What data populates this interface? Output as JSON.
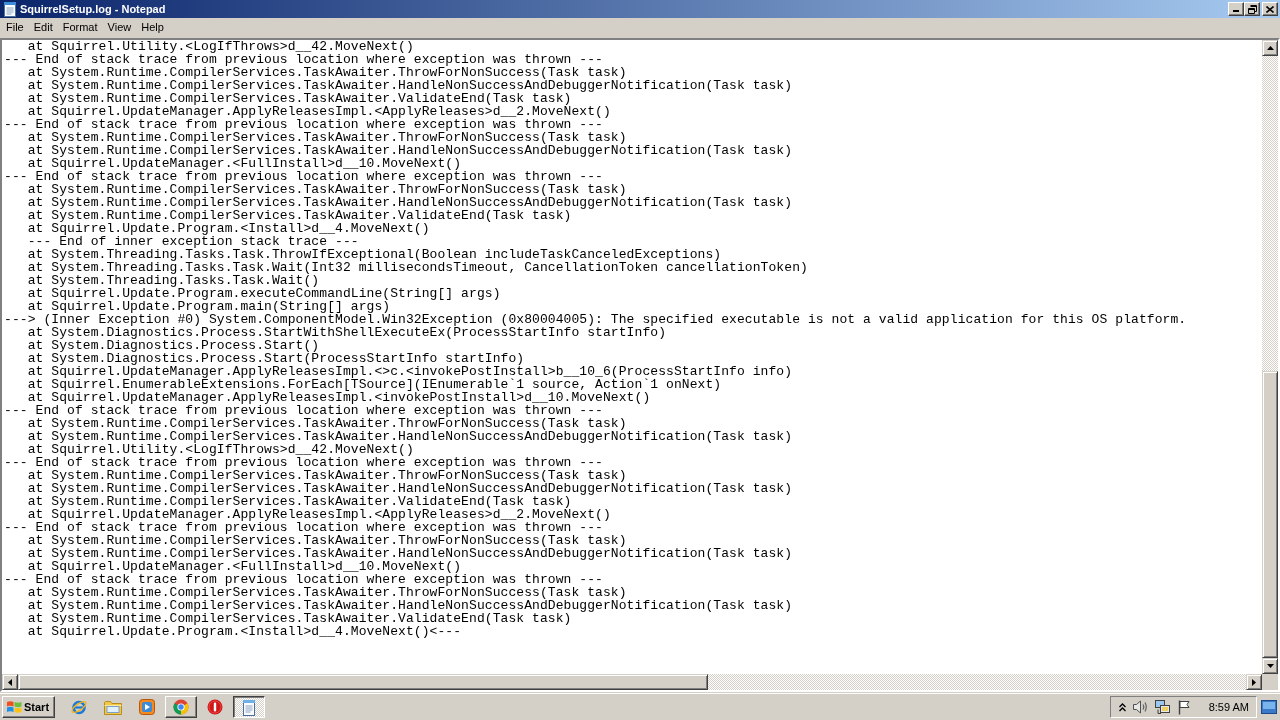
{
  "window": {
    "title": "SquirrelSetup.log - Notepad"
  },
  "menu": [
    "File",
    "Edit",
    "Format",
    "View",
    "Help"
  ],
  "editor": {
    "lines": [
      "   at Squirrel.Utility.<LogIfThrows>d__42.MoveNext()",
      "--- End of stack trace from previous location where exception was thrown ---",
      "   at System.Runtime.CompilerServices.TaskAwaiter.ThrowForNonSuccess(Task task)",
      "   at System.Runtime.CompilerServices.TaskAwaiter.HandleNonSuccessAndDebuggerNotification(Task task)",
      "   at System.Runtime.CompilerServices.TaskAwaiter.ValidateEnd(Task task)",
      "   at Squirrel.UpdateManager.ApplyReleasesImpl.<ApplyReleases>d__2.MoveNext()",
      "--- End of stack trace from previous location where exception was thrown ---",
      "   at System.Runtime.CompilerServices.TaskAwaiter.ThrowForNonSuccess(Task task)",
      "   at System.Runtime.CompilerServices.TaskAwaiter.HandleNonSuccessAndDebuggerNotification(Task task)",
      "   at Squirrel.UpdateManager.<FullInstall>d__10.MoveNext()",
      "--- End of stack trace from previous location where exception was thrown ---",
      "   at System.Runtime.CompilerServices.TaskAwaiter.ThrowForNonSuccess(Task task)",
      "   at System.Runtime.CompilerServices.TaskAwaiter.HandleNonSuccessAndDebuggerNotification(Task task)",
      "   at System.Runtime.CompilerServices.TaskAwaiter.ValidateEnd(Task task)",
      "   at Squirrel.Update.Program.<Install>d__4.MoveNext()",
      "   --- End of inner exception stack trace ---",
      "   at System.Threading.Tasks.Task.ThrowIfExceptional(Boolean includeTaskCanceledExceptions)",
      "   at System.Threading.Tasks.Task.Wait(Int32 millisecondsTimeout, CancellationToken cancellationToken)",
      "   at System.Threading.Tasks.Task.Wait()",
      "   at Squirrel.Update.Program.executeCommandLine(String[] args)",
      "   at Squirrel.Update.Program.main(String[] args)",
      "---> (Inner Exception #0) System.ComponentModel.Win32Exception (0x80004005): The specified executable is not a valid application for this OS platform.",
      "   at System.Diagnostics.Process.StartWithShellExecuteEx(ProcessStartInfo startInfo)",
      "   at System.Diagnostics.Process.Start()",
      "   at System.Diagnostics.Process.Start(ProcessStartInfo startInfo)",
      "   at Squirrel.UpdateManager.ApplyReleasesImpl.<>c.<invokePostInstall>b__10_6(ProcessStartInfo info)",
      "   at Squirrel.EnumerableExtensions.ForEach[TSource](IEnumerable`1 source, Action`1 onNext)",
      "   at Squirrel.UpdateManager.ApplyReleasesImpl.<invokePostInstall>d__10.MoveNext()",
      "--- End of stack trace from previous location where exception was thrown ---",
      "   at System.Runtime.CompilerServices.TaskAwaiter.ThrowForNonSuccess(Task task)",
      "   at System.Runtime.CompilerServices.TaskAwaiter.HandleNonSuccessAndDebuggerNotification(Task task)",
      "   at Squirrel.Utility.<LogIfThrows>d__42.MoveNext()",
      "--- End of stack trace from previous location where exception was thrown ---",
      "   at System.Runtime.CompilerServices.TaskAwaiter.ThrowForNonSuccess(Task task)",
      "   at System.Runtime.CompilerServices.TaskAwaiter.HandleNonSuccessAndDebuggerNotification(Task task)",
      "   at System.Runtime.CompilerServices.TaskAwaiter.ValidateEnd(Task task)",
      "   at Squirrel.UpdateManager.ApplyReleasesImpl.<ApplyReleases>d__2.MoveNext()",
      "--- End of stack trace from previous location where exception was thrown ---",
      "   at System.Runtime.CompilerServices.TaskAwaiter.ThrowForNonSuccess(Task task)",
      "   at System.Runtime.CompilerServices.TaskAwaiter.HandleNonSuccessAndDebuggerNotification(Task task)",
      "   at Squirrel.UpdateManager.<FullInstall>d__10.MoveNext()",
      "--- End of stack trace from previous location where exception was thrown ---",
      "   at System.Runtime.CompilerServices.TaskAwaiter.ThrowForNonSuccess(Task task)",
      "   at System.Runtime.CompilerServices.TaskAwaiter.HandleNonSuccessAndDebuggerNotification(Task task)",
      "   at System.Runtime.CompilerServices.TaskAwaiter.ValidateEnd(Task task)",
      "   at Squirrel.Update.Program.<Install>d__4.MoveNext()<---"
    ]
  },
  "taskbar": {
    "start": "Start",
    "items": [
      {
        "kind": "e-browser",
        "open": false,
        "selected": false
      },
      {
        "kind": "folder",
        "open": false,
        "selected": false
      },
      {
        "kind": "media-player",
        "open": false,
        "selected": false
      },
      {
        "kind": "round-browser",
        "open": true,
        "selected": false
      },
      {
        "kind": "stop-sign",
        "open": false,
        "selected": false
      },
      {
        "kind": "notepad",
        "open": true,
        "selected": true
      }
    ],
    "clock": "8:59 AM"
  }
}
